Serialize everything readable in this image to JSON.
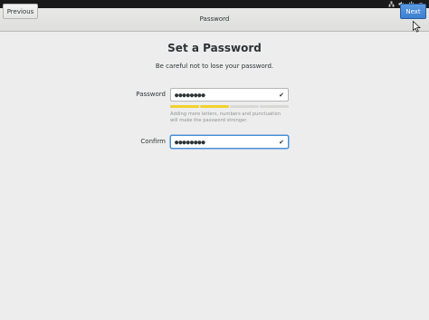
{
  "header": {
    "title": "Password",
    "previous_label": "Previous",
    "next_label": "Next"
  },
  "page": {
    "title": "Set a Password",
    "subtitle": "Be careful not to lose your password."
  },
  "form": {
    "password": {
      "label": "Password",
      "value": "●●●●●●●●",
      "valid": true
    },
    "password_strength": {
      "segments_filled": 2,
      "segments_total": 4,
      "hint": "Adding more letters, numbers and punctuation will make the password stronger."
    },
    "confirm": {
      "label": "Confirm",
      "value": "●●●●●●●●",
      "valid": true
    }
  },
  "tray": {
    "icons": [
      "network-icon",
      "volume-icon",
      "power-icon",
      "menu-chevron-icon"
    ]
  },
  "colors": {
    "accent": "#4a90d9",
    "strength_fill": "#f2d22e",
    "topbar": "#1a1a1a"
  }
}
